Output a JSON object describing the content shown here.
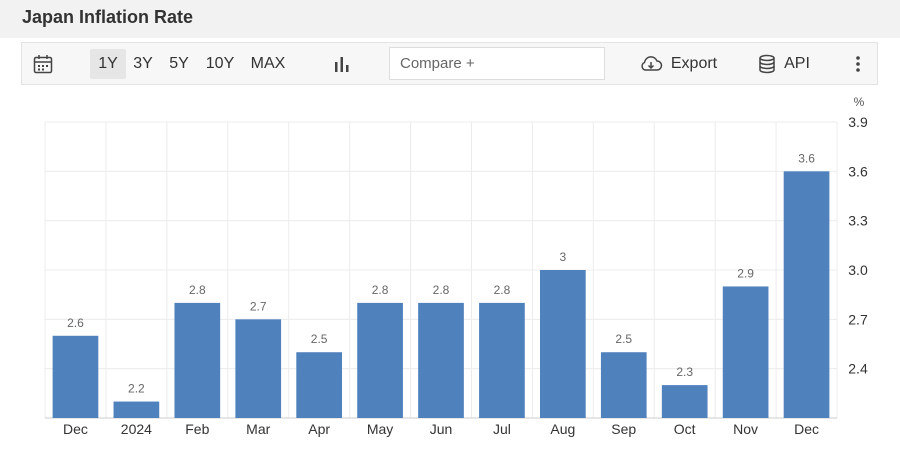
{
  "page": {
    "title": "Japan Inflation Rate"
  },
  "toolbar": {
    "ranges": [
      "1Y",
      "3Y",
      "5Y",
      "10Y",
      "MAX"
    ],
    "active_range": "1Y",
    "compare_placeholder": "Compare +",
    "export_label": "Export",
    "api_label": "API"
  },
  "colors": {
    "bar": "#4f81bd",
    "grid": "#ececec",
    "value_label": "#666666",
    "axis_text": "#333333"
  },
  "chart_data": {
    "type": "bar",
    "title": "",
    "xlabel": "",
    "ylabel": "",
    "unit": "%",
    "categories": [
      "Dec",
      "2024",
      "Feb",
      "Mar",
      "Apr",
      "May",
      "Jun",
      "Jul",
      "Aug",
      "Sep",
      "Oct",
      "Nov",
      "Dec"
    ],
    "values": [
      2.6,
      2.2,
      2.8,
      2.7,
      2.5,
      2.8,
      2.8,
      2.8,
      3.0,
      2.5,
      2.3,
      2.9,
      3.6
    ],
    "value_labels": [
      "2.6",
      "2.2",
      "2.8",
      "2.7",
      "2.5",
      "2.8",
      "2.8",
      "2.8",
      "3",
      "2.5",
      "2.3",
      "2.9",
      "3.6"
    ],
    "y_ticks": [
      "2.4",
      "2.7",
      "3.0",
      "3.3",
      "3.6",
      "3.9"
    ],
    "ylim": [
      2.1,
      3.9
    ],
    "y_axis_side": "right",
    "grid": true,
    "legend": false
  }
}
